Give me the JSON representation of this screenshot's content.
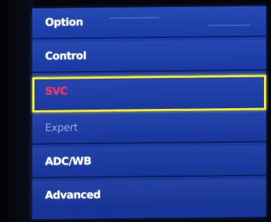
{
  "menu": {
    "items": [
      {
        "label": "Option",
        "state": "normal"
      },
      {
        "label": "Control",
        "state": "normal"
      },
      {
        "label": "SVC",
        "state": "selected"
      },
      {
        "label": "Expert",
        "state": "disabled"
      },
      {
        "label": "ADC/WB",
        "state": "normal"
      },
      {
        "label": "Advanced",
        "state": "normal"
      }
    ],
    "colors": {
      "background": "#1a3fae",
      "selection_border": "#f4ef2a",
      "selected_text": "#e8336a",
      "disabled_text": "#8ea6e6",
      "text": "#ffffff"
    }
  }
}
